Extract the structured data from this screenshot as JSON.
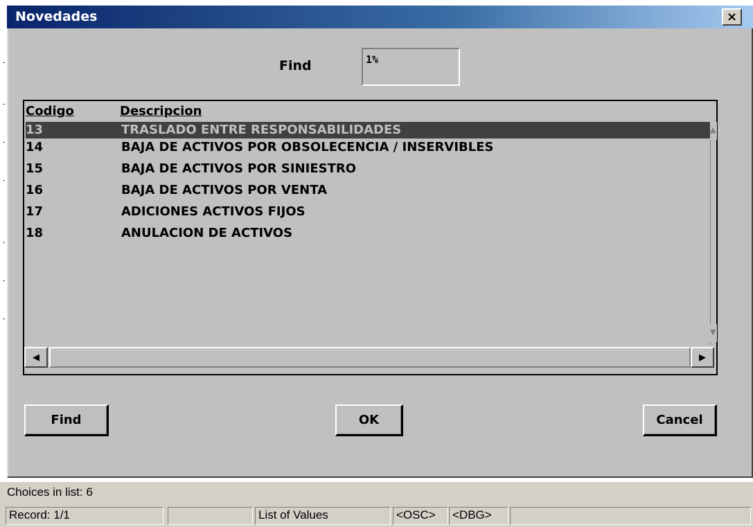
{
  "dialog": {
    "title": "Novedades",
    "close_glyph": "×"
  },
  "find": {
    "label": "Find",
    "value": "1%"
  },
  "list": {
    "headers": {
      "code": "Codigo",
      "description": "Descripcion"
    },
    "rows": [
      {
        "code": "13",
        "description": "TRASLADO ENTRE RESPONSABILIDADES",
        "selected": true
      },
      {
        "code": "14",
        "description": "BAJA DE ACTIVOS POR OBSOLECENCIA / INSERVIBLES",
        "selected": false
      },
      {
        "code": "15",
        "description": "BAJA DE ACTIVOS POR SINIESTRO",
        "selected": false
      },
      {
        "code": "16",
        "description": "BAJA DE ACTIVOS POR VENTA",
        "selected": false
      },
      {
        "code": "17",
        "description": "ADICIONES ACTIVOS FIJOS",
        "selected": false
      },
      {
        "code": "18",
        "description": "ANULACION DE ACTIVOS",
        "selected": false
      }
    ]
  },
  "buttons": {
    "find": "Find",
    "ok": "OK",
    "cancel": "Cancel"
  },
  "icons": {
    "scroll_up": "▲",
    "scroll_down": "▼",
    "scroll_left": "◀",
    "scroll_right": "▶"
  },
  "status": {
    "choices": "Choices in list: 6",
    "record": "Record: 1/1",
    "empty1": "",
    "mode": "List of Values",
    "osc": "<OSC>",
    "dbg": "<DBG>",
    "empty2": ""
  },
  "colors": {
    "title_start": "#0a246a",
    "title_end": "#a6caf0",
    "dialog_bg": "#c0c0c0",
    "selected_row_bg": "#404040"
  }
}
